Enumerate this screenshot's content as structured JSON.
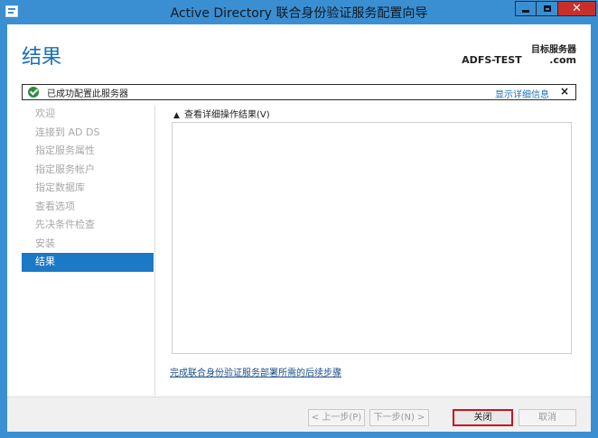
{
  "window": {
    "title": "Active Directory 联合身份验证服务配置向导"
  },
  "header": {
    "page_title": "结果",
    "target_server_label": "目标服务器",
    "target_server_name": "ADFS-TEST        .com"
  },
  "status": {
    "message": "已成功配置此服务器",
    "details_link": "显示详细信息",
    "close_glyph": "×"
  },
  "nav": {
    "items": [
      {
        "label": "欢迎",
        "active": false
      },
      {
        "label": "连接到 AD DS",
        "active": false
      },
      {
        "label": "指定服务属性",
        "active": false
      },
      {
        "label": "指定服务帐户",
        "active": false
      },
      {
        "label": "指定数据库",
        "active": false
      },
      {
        "label": "查看选项",
        "active": false
      },
      {
        "label": "先决条件检查",
        "active": false
      },
      {
        "label": "安装",
        "active": false
      },
      {
        "label": "结果",
        "active": true
      }
    ]
  },
  "main": {
    "expander_label": "查看详细操作结果(V)",
    "next_steps_link": "完成联合身份验证服务部署所需的后续步骤"
  },
  "footer": {
    "prev_label": "< 上一步(P)",
    "next_label": "下一步(N) >",
    "close_label": "关闭",
    "cancel_label": "取消"
  },
  "colors": {
    "frame": "#3a8fd2",
    "accent": "#1b70b5",
    "nav_active": "#1c79c6",
    "success": "#2e8b3a",
    "highlight": "#c8141c"
  }
}
